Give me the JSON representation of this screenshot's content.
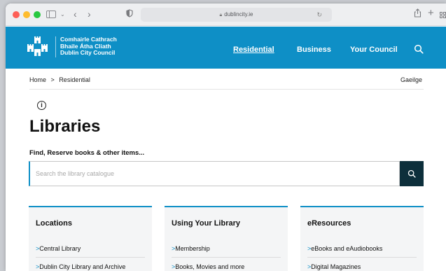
{
  "browser": {
    "url": "dublincity.ie",
    "icons": [
      "sidebar-icon",
      "chevron-down-icon",
      "back-arrow-icon",
      "forward-arrow-icon",
      "privacy-shield-icon",
      "lock-icon",
      "reload-icon",
      "share-icon",
      "new-tab-icon",
      "tab-overview-icon"
    ]
  },
  "header": {
    "logo_line1": "Comhairle Cathrach",
    "logo_line2": "Bhaile Átha Cliath",
    "logo_line3": "Dublin City Council",
    "nav": [
      "Residential",
      "Business",
      "Your Council"
    ],
    "brand_color": "#0e8fc6"
  },
  "breadcrumb": {
    "home": "Home",
    "separator": ">",
    "current": "Residential"
  },
  "language_link": "Gaeilge",
  "page_title": "Libraries",
  "search": {
    "label": "Find, Reserve books & other items...",
    "placeholder": "Search the library catalogue"
  },
  "cards": [
    {
      "title": "Locations",
      "links": [
        "Central Library",
        "Dublin City Library and Archive"
      ]
    },
    {
      "title": "Using Your Library",
      "links": [
        "Membership",
        "Books, Movies and more"
      ]
    },
    {
      "title": "eResources",
      "links": [
        "eBooks and eAudiobooks",
        "Digital Magazines"
      ]
    }
  ]
}
